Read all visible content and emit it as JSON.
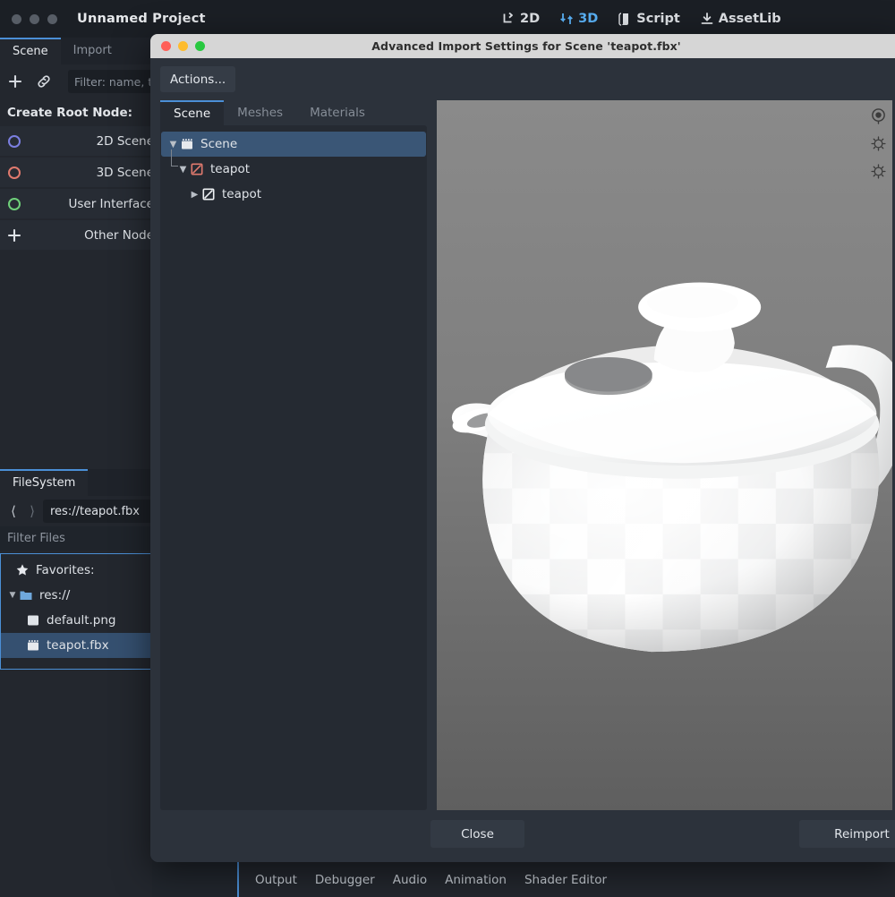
{
  "main_window": {
    "title": "Unnamed Project",
    "traffic_lights": [
      "close-light",
      "minimize-light",
      "maximize-light"
    ],
    "toolbar": [
      {
        "label": "2D",
        "icon": "2d-icon",
        "active": false
      },
      {
        "label": "3D",
        "icon": "3d-icon",
        "active": true
      },
      {
        "label": "Script",
        "icon": "script-icon",
        "active": false
      },
      {
        "label": "AssetLib",
        "icon": "assetlib-icon",
        "active": false
      }
    ]
  },
  "scene_dock": {
    "tabs": [
      {
        "label": "Scene",
        "active": true
      },
      {
        "label": "Import",
        "active": false
      }
    ],
    "add_icon": "plus-icon",
    "link_icon": "link-icon",
    "filter_placeholder": "Filter: name, t:",
    "create_root_label": "Create Root Node:",
    "root_nodes": [
      {
        "label": "2D Scene",
        "icon": "node2d-icon",
        "color": "#7b7fe0"
      },
      {
        "label": "3D Scene",
        "icon": "node3d-icon",
        "color": "#e07a6e"
      },
      {
        "label": "User Interface",
        "icon": "control-icon",
        "color": "#6fd07a"
      },
      {
        "label": "Other Node",
        "icon": "plus-icon",
        "color": "#dfe3e8"
      }
    ]
  },
  "filesystem_dock": {
    "tab_label": "FileSystem",
    "back_icon": "chevron-left-icon",
    "forward_icon": "chevron-right-icon",
    "path": "res://teapot.fbx",
    "filter_placeholder": "Filter Files",
    "tree": [
      {
        "label": "Favorites:",
        "icon": "star-icon",
        "indent": 1,
        "twisty": "",
        "selected": false
      },
      {
        "label": "res://",
        "icon": "folder-icon",
        "indent": 0,
        "twisty": "⌄",
        "selected": false
      },
      {
        "label": "default.png",
        "icon": "image-file-icon",
        "indent": 2,
        "twisty": "",
        "selected": false
      },
      {
        "label": "teapot.fbx",
        "icon": "scene-file-icon",
        "indent": 2,
        "twisty": "",
        "selected": true
      }
    ]
  },
  "bottom_panel": {
    "tabs": [
      "Output",
      "Debugger",
      "Audio",
      "Animation",
      "Shader Editor"
    ]
  },
  "dialog": {
    "title": "Advanced Import Settings for Scene 'teapot.fbx'",
    "traffic_lights": [
      {
        "name": "close-light",
        "color": "#ff5f57"
      },
      {
        "name": "minimize-light",
        "color": "#febc2e"
      },
      {
        "name": "maximize-light",
        "color": "#28c840"
      }
    ],
    "actions_button": "Actions...",
    "tabs": [
      {
        "label": "Scene",
        "active": true
      },
      {
        "label": "Meshes",
        "active": false
      },
      {
        "label": "Materials",
        "active": false
      }
    ],
    "tree": [
      {
        "label": "Scene",
        "icon": "scene-root-icon",
        "indent": 0,
        "twisty": "⌄",
        "selected": true
      },
      {
        "label": "teapot",
        "icon": "node3d-icon",
        "indent": 1,
        "twisty": "⌄",
        "selected": false
      },
      {
        "label": "teapot",
        "icon": "meshinstance3d-icon",
        "indent": 2,
        "twisty": "›",
        "selected": false
      }
    ],
    "viewport": {
      "model": "teapot-3d-preview",
      "gizmos": [
        {
          "name": "rotate-gizmo-icon"
        },
        {
          "name": "light-1-gizmo-icon"
        },
        {
          "name": "light-2-gizmo-icon"
        }
      ]
    },
    "close_button": "Close",
    "reimport_button": "Reimport"
  },
  "colors": {
    "accent_blue": "#4b8fd6",
    "active_tab_text": "#5ab2f7",
    "panel_bg": "#23272e",
    "dialog_bg": "#2c323b",
    "selection_blue": "#3a5676"
  }
}
